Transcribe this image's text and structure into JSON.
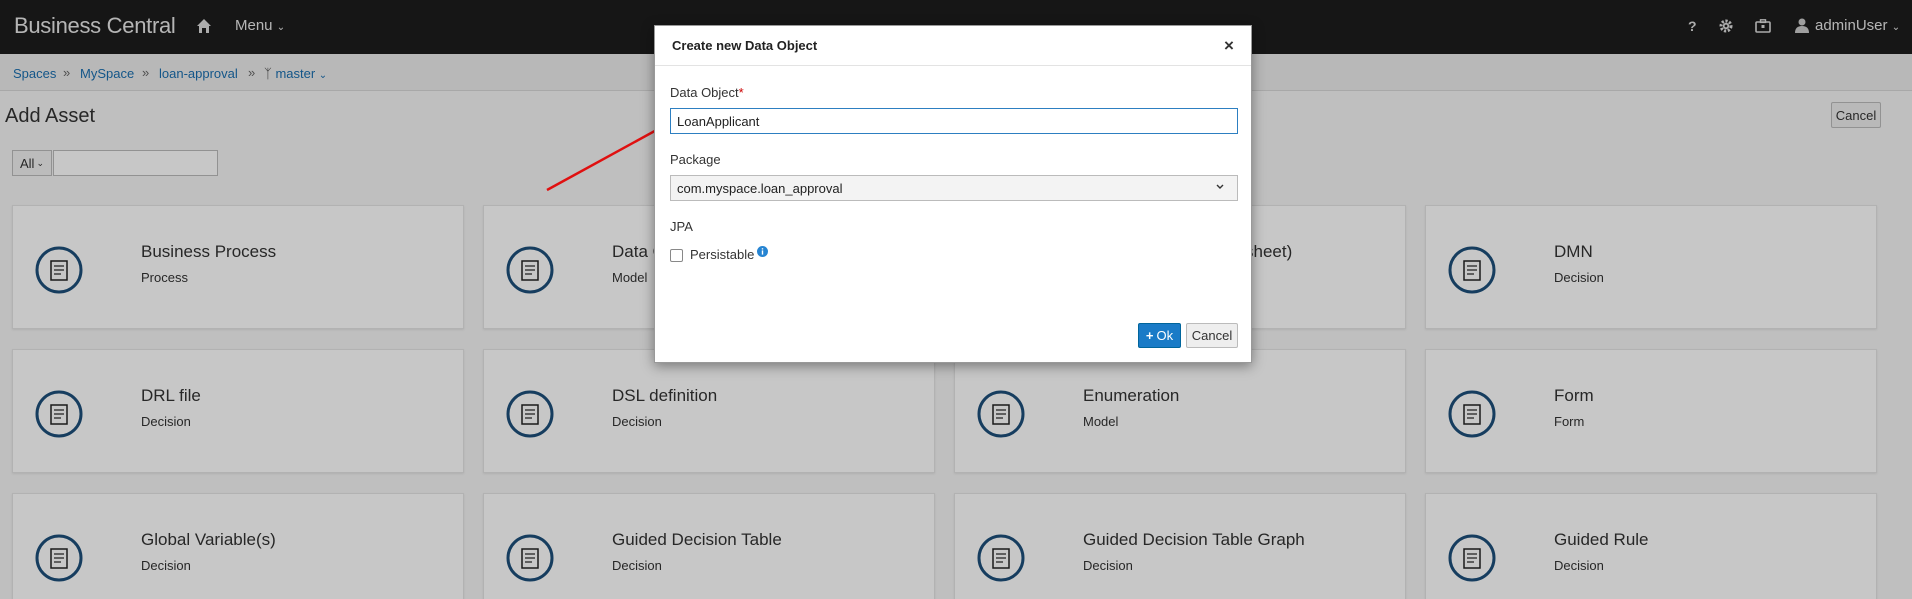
{
  "nav": {
    "brand": "Business Central",
    "menu_label": "Menu",
    "help_label": "?",
    "user_name": "adminUser"
  },
  "breadcrumb": {
    "items": [
      "Spaces",
      "MySpace",
      "loan-approval",
      "master"
    ],
    "separator": "»"
  },
  "page": {
    "title": "Add Asset",
    "cancel_label": "Cancel",
    "filter_label": "All"
  },
  "cards": [
    {
      "title": "Business Process",
      "sub": "Process",
      "icon": "process-icon"
    },
    {
      "title": "Data O",
      "sub": "Model",
      "icon": "data-object-icon"
    },
    {
      "title": "sheet)",
      "sub": "",
      "icon": ""
    },
    {
      "title": "DMN",
      "sub": "Decision",
      "icon": "dmn-icon"
    },
    {
      "title": "DRL file",
      "sub": "Decision",
      "icon": "drl-icon"
    },
    {
      "title": "DSL definition",
      "sub": "Decision",
      "icon": "dsl-icon"
    },
    {
      "title": "Enumeration",
      "sub": "Model",
      "icon": "enumeration-icon"
    },
    {
      "title": "Form",
      "sub": "Form",
      "icon": "form-icon"
    },
    {
      "title": "Global Variable(s)",
      "sub": "Decision",
      "icon": "global-variable-icon"
    },
    {
      "title": "Guided Decision Table",
      "sub": "Decision",
      "icon": "decision-table-icon"
    },
    {
      "title": "Guided Decision Table Graph",
      "sub": "Decision",
      "icon": "decision-table-graph-icon"
    },
    {
      "title": "Guided Rule",
      "sub": "Decision",
      "icon": "guided-rule-icon"
    }
  ],
  "modal": {
    "title": "Create new Data Object",
    "close_label": "×",
    "data_object_label": "Data Object",
    "required_mark": "*",
    "data_object_value": "LoanApplicant",
    "package_label": "Package",
    "package_value": "com.myspace.loan_approval",
    "jpa_label": "JPA",
    "persistable_label": "Persistable",
    "persistable_checked": false,
    "ok_label": "Ok",
    "cancel_label": "Cancel"
  },
  "colors": {
    "primary": "#1a7bc7",
    "nav_bg": "#1d1d1d",
    "icon_ring": "#1d4f7a",
    "annotation_arrow": "#e01010"
  }
}
